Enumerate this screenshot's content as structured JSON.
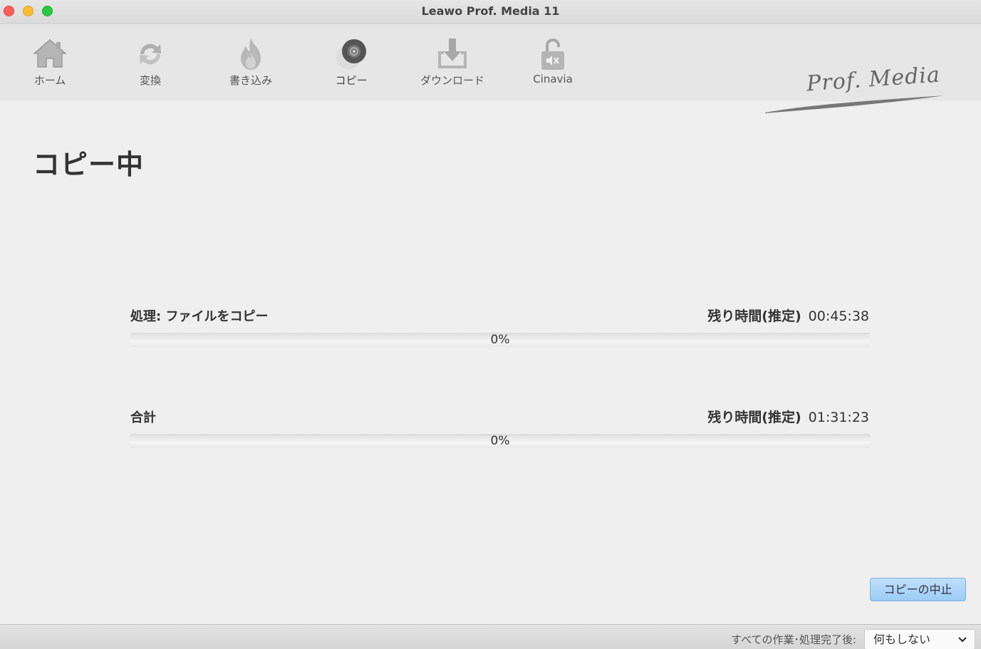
{
  "window": {
    "title": "Leawo Prof. Media 11"
  },
  "toolbar": {
    "items": [
      {
        "label": "ホーム",
        "icon": "home-icon"
      },
      {
        "label": "変換",
        "icon": "convert-icon"
      },
      {
        "label": "書き込み",
        "icon": "burn-icon"
      },
      {
        "label": "コピー",
        "icon": "copy-disc-icon",
        "active": true
      },
      {
        "label": "ダウンロード",
        "icon": "download-icon"
      },
      {
        "label": "Cinavia",
        "icon": "cinavia-icon"
      }
    ],
    "brand": "Prof. Media"
  },
  "main": {
    "heading": "コピー中",
    "task": {
      "label": "処理: ファイルをコピー",
      "time_label": "残り時間(推定)",
      "time_value": "00:45:38",
      "progress": 0,
      "progress_text": "0%"
    },
    "total": {
      "label": "合計",
      "time_label": "残り時間(推定)",
      "time_value": "01:31:23",
      "progress": 0,
      "progress_text": "0%"
    },
    "stop_button": "コピーの中止"
  },
  "statusbar": {
    "after_label": "すべての作業･処理完了後:",
    "after_value": "何もしない"
  },
  "colors": {
    "accent": "#9ccbf4",
    "progress": "#6aa8e8"
  }
}
